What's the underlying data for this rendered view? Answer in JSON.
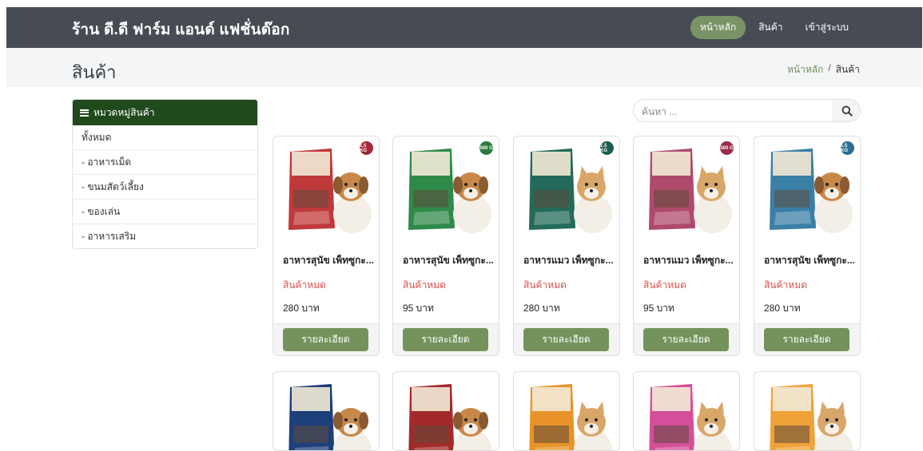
{
  "header": {
    "brand": "ร้าน ดี.ดี ฟาร์ม แอนด์ แฟชั่นด๊อก",
    "nav": [
      "หน้าหลัก",
      "สินค้า",
      "เข้าสู่ระบบ"
    ]
  },
  "titlebar": {
    "title": "สินค้า",
    "breadcrumb": {
      "home": "หน้าหลัก",
      "separator": "/",
      "current": "สินค้า"
    }
  },
  "sidebar": {
    "heading": "หมวดหมู่สินค้า",
    "items": [
      "ทั้งหมด",
      "- อาหารเม็ด",
      "- ขนมสัตว์เลี้ยง",
      "- ของเล่น",
      "- อาหารเสริม"
    ]
  },
  "search": {
    "placeholder": "ค้นหา ..."
  },
  "products": [
    {
      "name": "อาหารสุนัข เพ็ทซูกะ...",
      "status": "สินค้าหมด",
      "price": "280 บาท",
      "button": "รายละเอียด",
      "badge": "1.5 KG",
      "pack_color": "#c0393a",
      "badge_color": "#a3293a",
      "animal": "dog"
    },
    {
      "name": "อาหารสุนัข เพ็ทซูกะ...",
      "status": "สินค้าหมด",
      "price": "95 บาท",
      "button": "รายละเอียด",
      "badge": "500 G",
      "pack_color": "#2f8a4a",
      "badge_color": "#2b7a3d",
      "animal": "dog"
    },
    {
      "name": "อาหารแมว เพ็ทซูกะ...",
      "status": "สินค้าหมด",
      "price": "280 บาท",
      "button": "รายละเอียด",
      "badge": "1.5 KG",
      "pack_color": "#236a5a",
      "badge_color": "#1f5d50",
      "animal": "cat"
    },
    {
      "name": "อาหารแมว เพ็ทซูกะ...",
      "status": "สินค้าหมด",
      "price": "95 บาท",
      "button": "รายละเอียด",
      "badge": "500 G",
      "pack_color": "#b04a6c",
      "badge_color": "#9a2d4c",
      "animal": "cat"
    },
    {
      "name": "อาหารสุนัข เพ็ทซูกะ...",
      "status": "สินค้าหมด",
      "price": "280 บาท",
      "button": "รายละเอียด",
      "badge": "1.5 KG",
      "pack_color": "#3a7fa6",
      "badge_color": "#2e6d8d",
      "animal": "dog"
    }
  ],
  "products_row2": [
    {
      "pack_color": "#1d3f7a",
      "animal": "dog"
    },
    {
      "pack_color": "#a32a2a",
      "animal": "dog"
    },
    {
      "pack_color": "#e8932a",
      "animal": "cat"
    },
    {
      "pack_color": "#d44f9a",
      "animal": "cat"
    },
    {
      "pack_color": "#f0a23a",
      "animal": "cat"
    }
  ],
  "colors": {
    "topbar": "#474c54",
    "accent": "#74935c",
    "category_header": "#1f4a1c",
    "out_of_stock": "#d9534f"
  }
}
